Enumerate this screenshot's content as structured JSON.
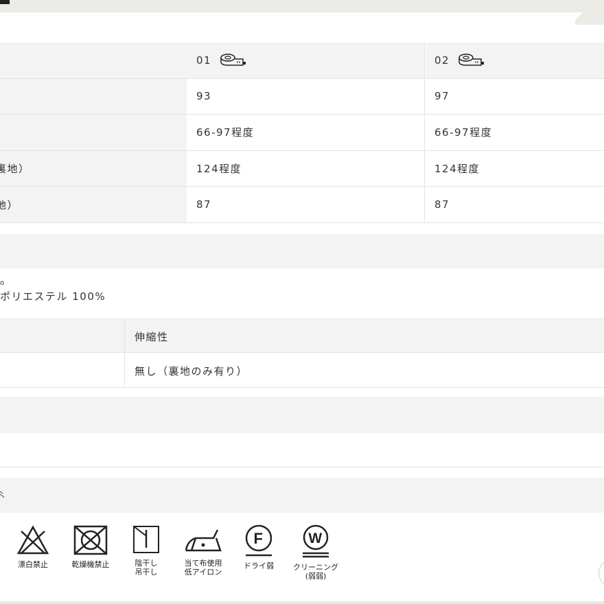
{
  "size_table": {
    "headers": [
      "01",
      "02"
    ],
    "rows": [
      {
        "label": "",
        "col1": "93",
        "col2": "97"
      },
      {
        "label": "",
        "col1": "66-97程度",
        "col2": "66-97程度"
      },
      {
        "label": "裏地）",
        "col1": "124程度",
        "col2": "124程度"
      },
      {
        "label": "地）",
        "col1": "87",
        "col2": "87"
      }
    ]
  },
  "material": {
    "fragment": "o",
    "line": "ポリエステル 100%"
  },
  "stretch": {
    "header": "伸縮性",
    "value": "無し（裏地のみ有り）"
  },
  "care_labels": [
    {
      "icon": "no-bleach-icon",
      "caption": "漂白禁止"
    },
    {
      "icon": "no-tumble-dry-icon",
      "caption": "乾燥機禁止"
    },
    {
      "icon": "shade-line-dry-icon",
      "caption": "陰干し\n吊干し"
    },
    {
      "icon": "low-iron-icon",
      "caption": "当て布使用\n低アイロン"
    },
    {
      "icon": "dry-clean-icon",
      "caption": "ドライ弱"
    },
    {
      "icon": "wet-clean-icon",
      "caption": "クリーニング\n(弱弱)"
    }
  ]
}
